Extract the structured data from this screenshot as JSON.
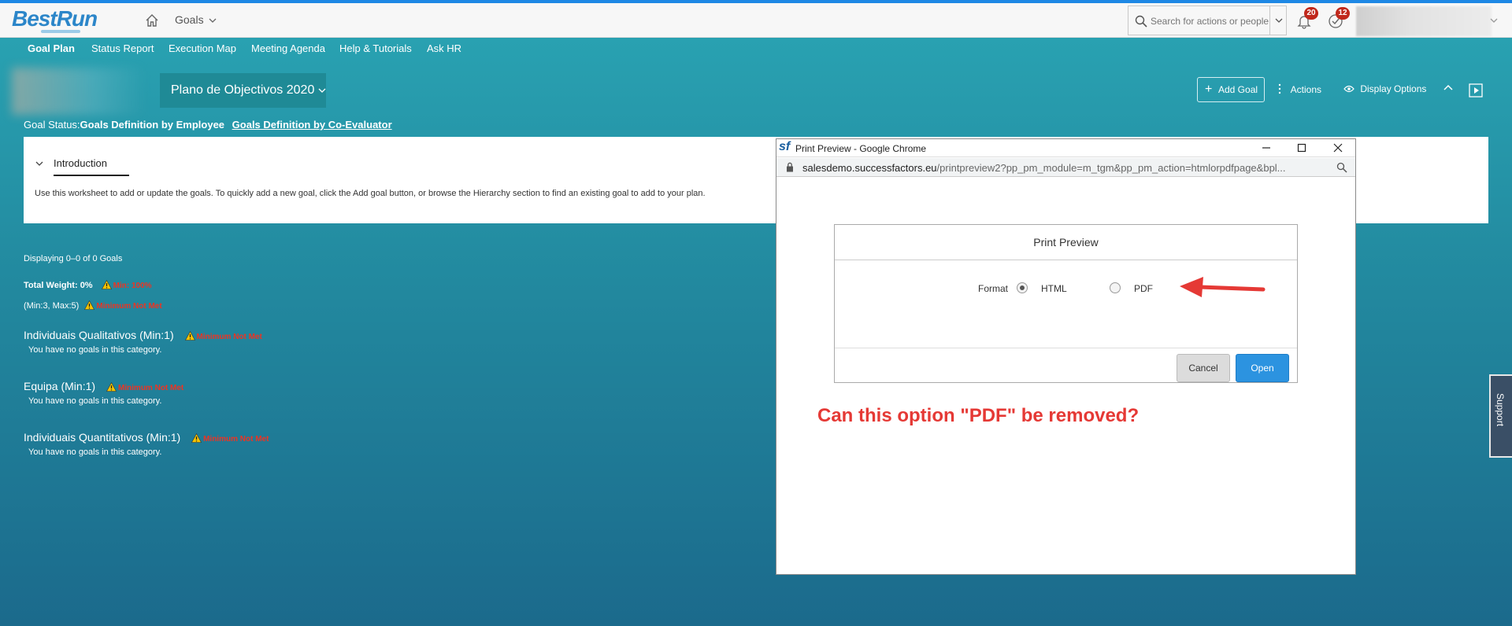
{
  "shell": {
    "logo": "BestRun",
    "menu_label": "Goals",
    "search_placeholder": "Search for actions or people",
    "notifications_count": "20",
    "tasks_count": "12"
  },
  "subnav": {
    "items": [
      "Goal Plan",
      "Status Report",
      "Execution Map",
      "Meeting Agenda",
      "Help & Tutorials",
      "Ask HR"
    ]
  },
  "header": {
    "plan_title": "Plano de Objectivos 2020",
    "add_goal": "Add Goal",
    "actions": "Actions",
    "display_options": "Display Options"
  },
  "goal_status": {
    "prefix": "Goal Status:",
    "current": "Goals Definition by Employee",
    "next_link": "Goals Definition by Co-Evaluator"
  },
  "intro": {
    "tab_label": "Introduction",
    "text": "Use this worksheet to add or update the goals. To quickly add a new goal, click the Add goal button, or browse the Hierarchy section to find an existing goal to add to your plan."
  },
  "summary": {
    "displaying": "Displaying 0–0 of 0 Goals",
    "total_weight": "Total Weight: 0%",
    "total_weight_warn": "Min: 100%",
    "minmax": "(Min:3, Max:5)",
    "minmax_warn": "Minimum Not Met"
  },
  "categories": [
    {
      "name": "Individuais Qualitativos  (Min:1)",
      "warn": "Minimum Not Met",
      "empty": "You have no goals in this category."
    },
    {
      "name": "Equipa  (Min:1)",
      "warn": "Minimum Not Met",
      "empty": "You have no goals in this category."
    },
    {
      "name": "Individuais Quantitativos  (Min:1)",
      "warn": "Minimum Not Met",
      "empty": "You have no goals in this category."
    }
  ],
  "popup": {
    "window_title": "Print Preview - Google Chrome",
    "url_host": "salesdemo.successfactors.eu",
    "url_path": "/printpreview2?pp_pm_module=m_tgm&pp_pm_action=htmlorpdfpage&bpl...",
    "dialog_title": "Print Preview",
    "format_label": "Format",
    "option_html": "HTML",
    "option_pdf": "PDF",
    "cancel": "Cancel",
    "open": "Open",
    "annotation": "Can this option \"PDF\" be removed?"
  },
  "support_tab": "Support",
  "colors": {
    "accent": "#2c93e0",
    "annotation": "#e53935",
    "warning": "#e32222"
  }
}
